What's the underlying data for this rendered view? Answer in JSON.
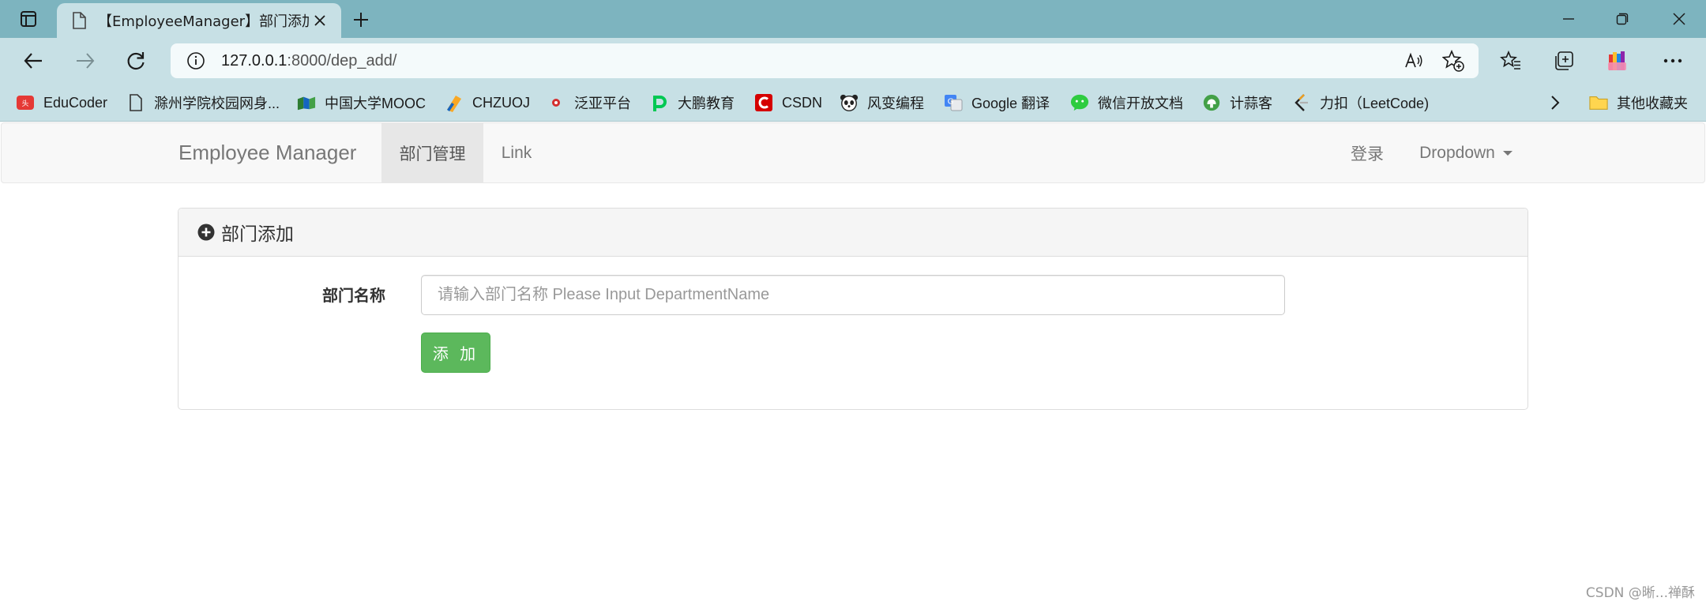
{
  "browser": {
    "tab_title": "【EmployeeManager】部门添加",
    "url_host": "127.0.0.1",
    "url_rest": ":8000/dep_add/"
  },
  "favorites": [
    {
      "label": "EduCoder",
      "icon": "toutiao-icon"
    },
    {
      "label": "滁州学院校园网身...",
      "icon": "page-icon"
    },
    {
      "label": "中国大学MOOC",
      "icon": "mooc-icon"
    },
    {
      "label": "CHZUOJ",
      "icon": "chzuoj-icon"
    },
    {
      "label": "泛亚平台",
      "icon": "fanya-icon"
    },
    {
      "label": "大鹏教育",
      "icon": "dapeng-icon"
    },
    {
      "label": "CSDN",
      "icon": "csdn-icon"
    },
    {
      "label": "风变编程",
      "icon": "panda-icon"
    },
    {
      "label": "Google 翻译",
      "icon": "google-translate-icon"
    },
    {
      "label": "微信开放文档",
      "icon": "wechat-icon"
    },
    {
      "label": "计蒜客",
      "icon": "jisuanke-icon"
    },
    {
      "label": "力扣（LeetCode)",
      "icon": "leetcode-icon"
    },
    {
      "label": "其他收藏夹",
      "icon": "folder-icon"
    }
  ],
  "navbar": {
    "brand": "Employee Manager",
    "items": [
      {
        "label": "部门管理",
        "active": true
      },
      {
        "label": "Link",
        "active": false
      }
    ],
    "right": {
      "login": "登录",
      "dropdown": "Dropdown"
    }
  },
  "panel": {
    "title": "部门添加",
    "field_label": "部门名称",
    "field_placeholder": "请输入部门名称 Please Input DepartmentName",
    "field_value": "",
    "submit_label": "添 加"
  },
  "watermark": "CSDN @晰...禅酥",
  "colors": {
    "tabstrip": "#7db4bf",
    "toolbar": "#c7e0e5",
    "success": "#5cb85c"
  }
}
